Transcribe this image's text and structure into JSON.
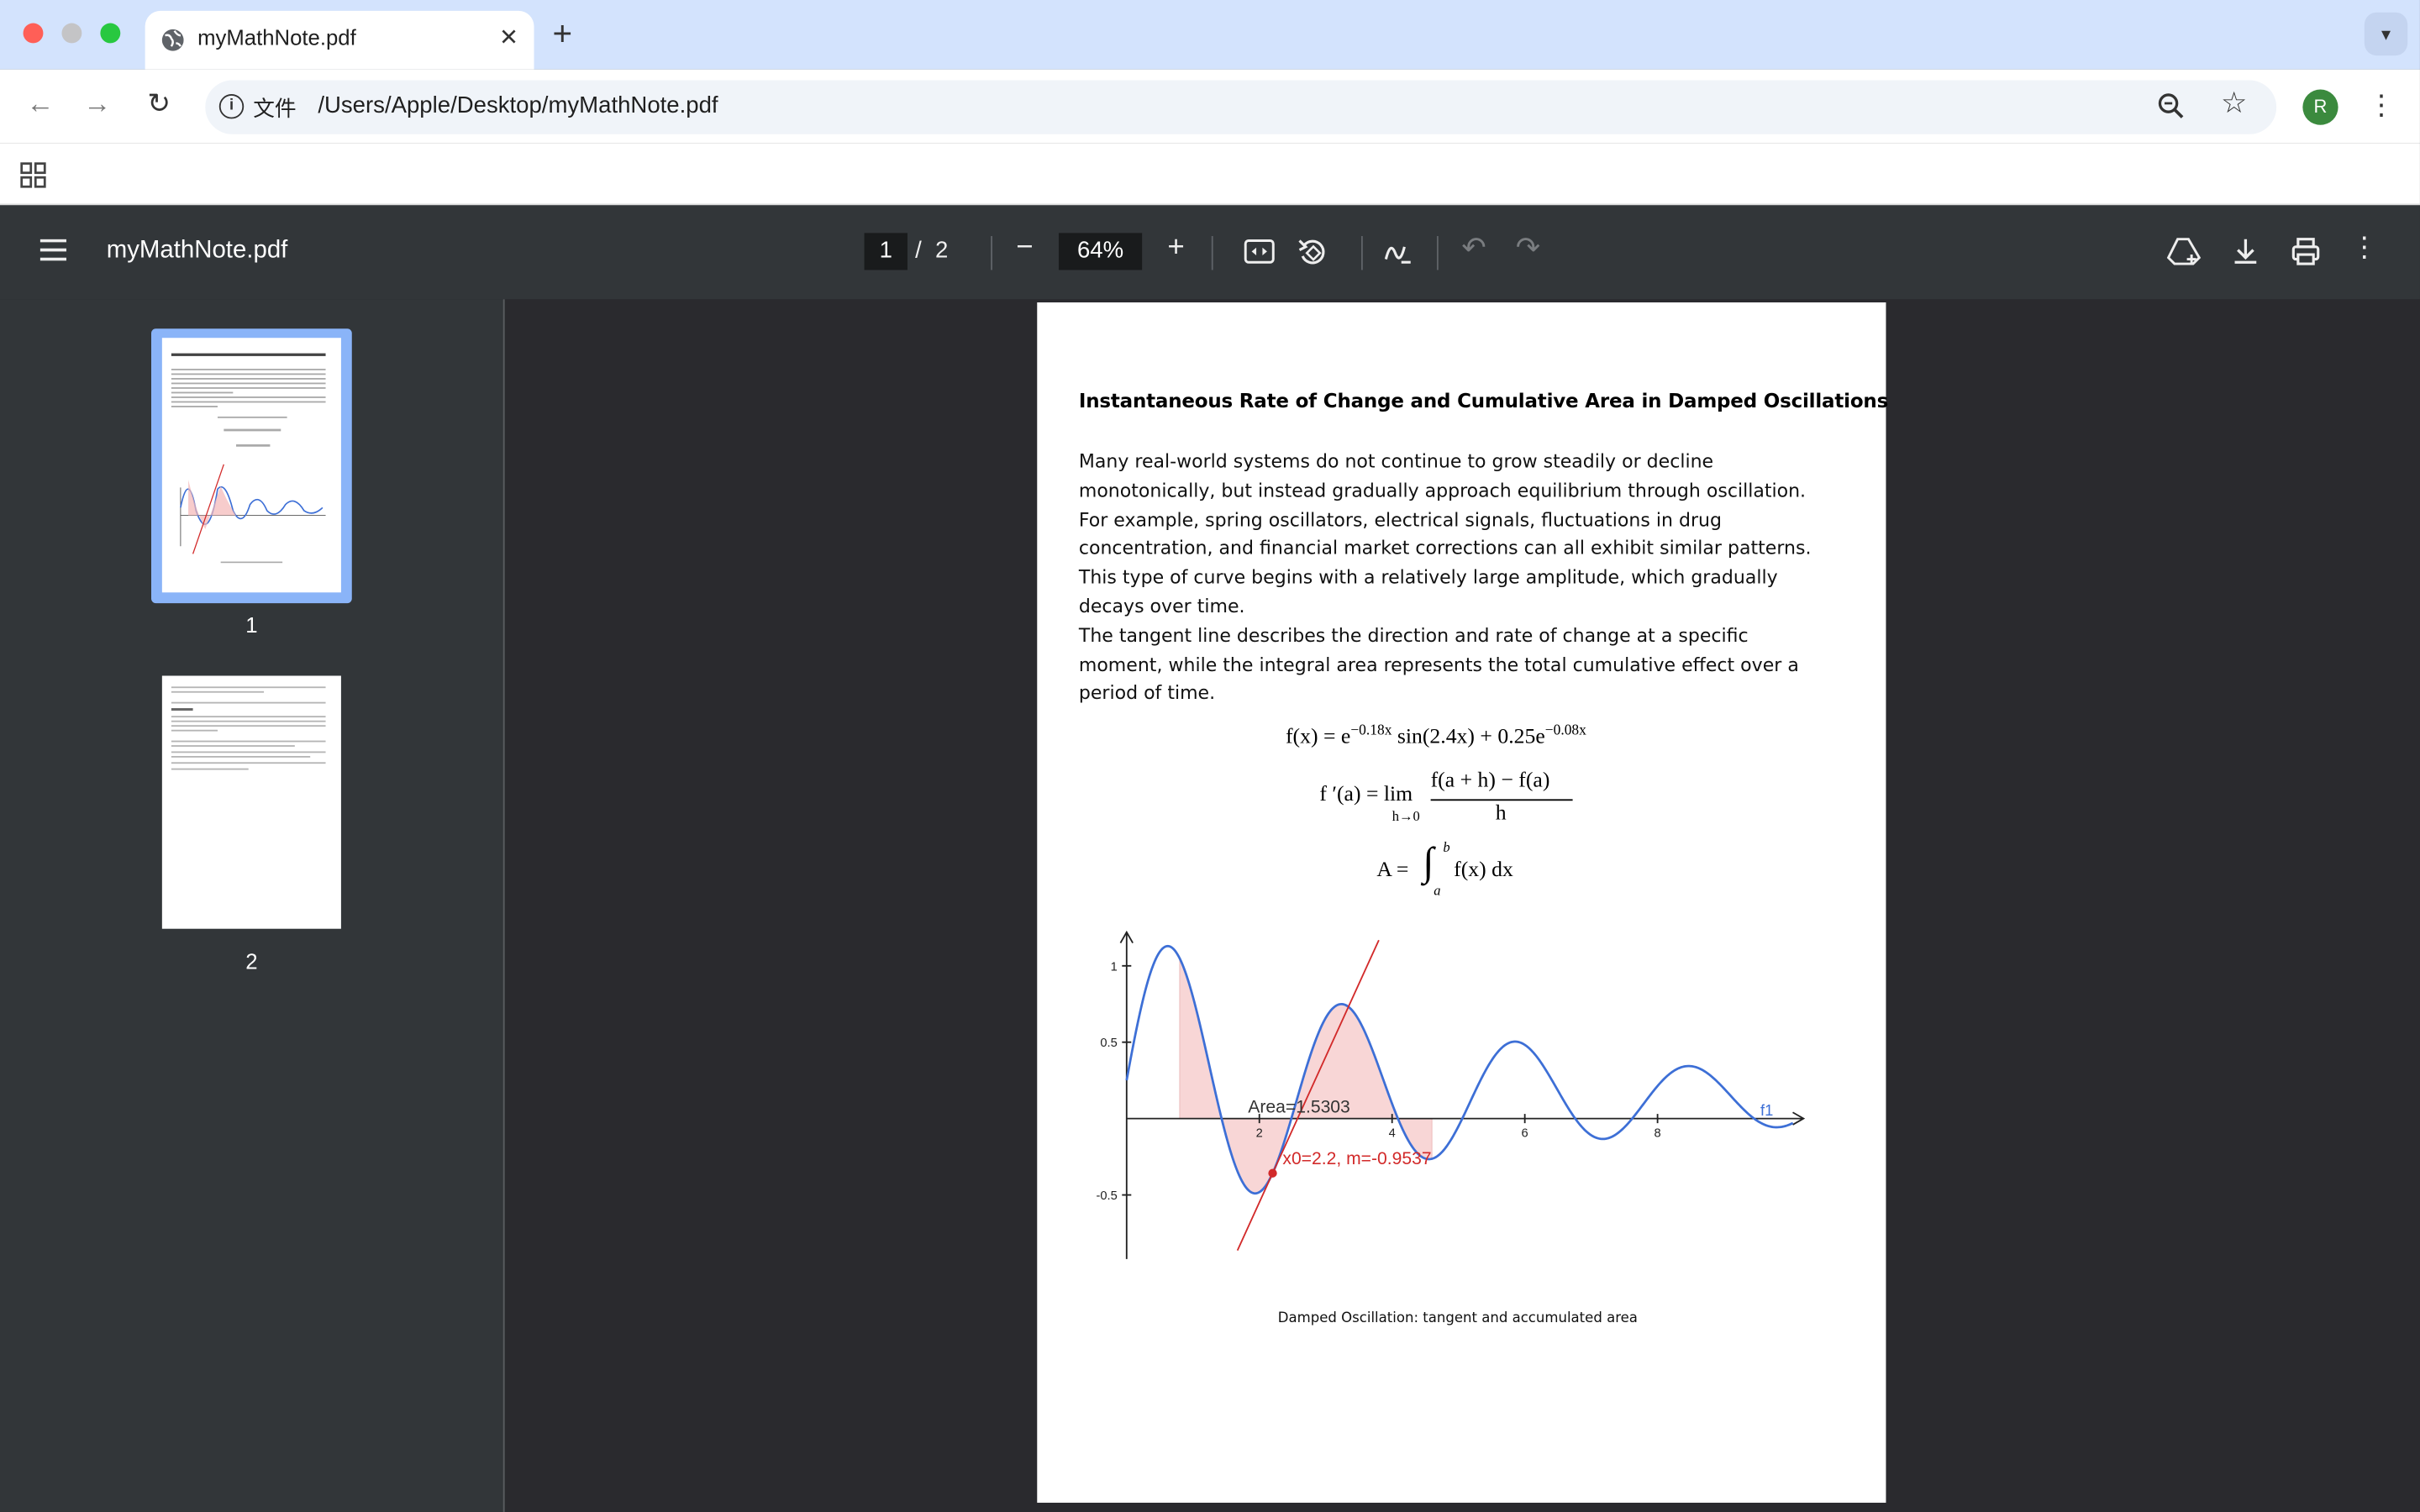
{
  "tab": {
    "title": "myMathNote.pdf"
  },
  "omnibox": {
    "scheme_label": "文件",
    "url": "/Users/Apple/Desktop/myMathNote.pdf"
  },
  "profile": {
    "initial": "R",
    "color": "#3b8a3e"
  },
  "viewer": {
    "doc_name": "myMathNote.pdf",
    "current_page": "1",
    "page_separator": "/",
    "total_pages": "2",
    "zoom": "64%"
  },
  "thumbnails": [
    {
      "label": "1"
    },
    {
      "label": "2"
    }
  ],
  "document": {
    "title": "Instantaneous Rate of Change and Cumulative Area in Damped Oscillations",
    "paragraph1": [
      "Many real-world systems do not continue to grow steadily or decline",
      "monotonically, but instead gradually approach equilibrium through oscillation.",
      "For example, spring oscillators, electrical signals, fluctuations in drug",
      "concentration, and financial market corrections can all exhibit similar patterns.",
      "This type of curve begins with a relatively large amplitude, which gradually",
      "decays over time."
    ],
    "paragraph2": [
      "The tangent line describes the direction and rate of change at a specific",
      "moment, while the integral area represents the total cumulative effect over a",
      "period of time."
    ],
    "equations": {
      "eq1_lhs": "f(x) = e",
      "eq1_exp1": "−0.18x",
      "eq1_mid": " sin(2.4x) + 0.25e",
      "eq1_exp2": "−0.08x",
      "eq2_lhs": "f ′(a) = lim",
      "eq2_sub": "h→0",
      "eq2_num": "f(a + h) − f(a)",
      "eq2_den": "h",
      "eq3_lhs": "A = ",
      "eq3_int": "∫",
      "eq3_upper": "b",
      "eq3_lower": "a",
      "eq3_rhs": "f(x) dx"
    },
    "caption": "Damped Oscillation: tangent and accumulated area"
  },
  "chart_data": {
    "type": "line",
    "function": "f(x) = e^(-0.18x) sin(2.4x) + 0.25e^(-0.08x)",
    "series": [
      {
        "name": "f1",
        "color": "#3d6fd6"
      }
    ],
    "xlim": [
      0,
      10
    ],
    "ylim": [
      -0.9,
      1.2
    ],
    "x_ticks": [
      2,
      4,
      6,
      8
    ],
    "y_ticks": [
      1,
      0.5,
      -0.5
    ],
    "shaded_area": {
      "from": 0.8,
      "to": 4.6,
      "color": "#f4b6b6"
    },
    "area_label": "Area=1.5303",
    "tangent": {
      "x0": 2.2,
      "slope": -0.9537,
      "color": "#d22a2a"
    },
    "tangent_label": "x0=2.2, m=-0.9537",
    "series_label": "f1"
  }
}
